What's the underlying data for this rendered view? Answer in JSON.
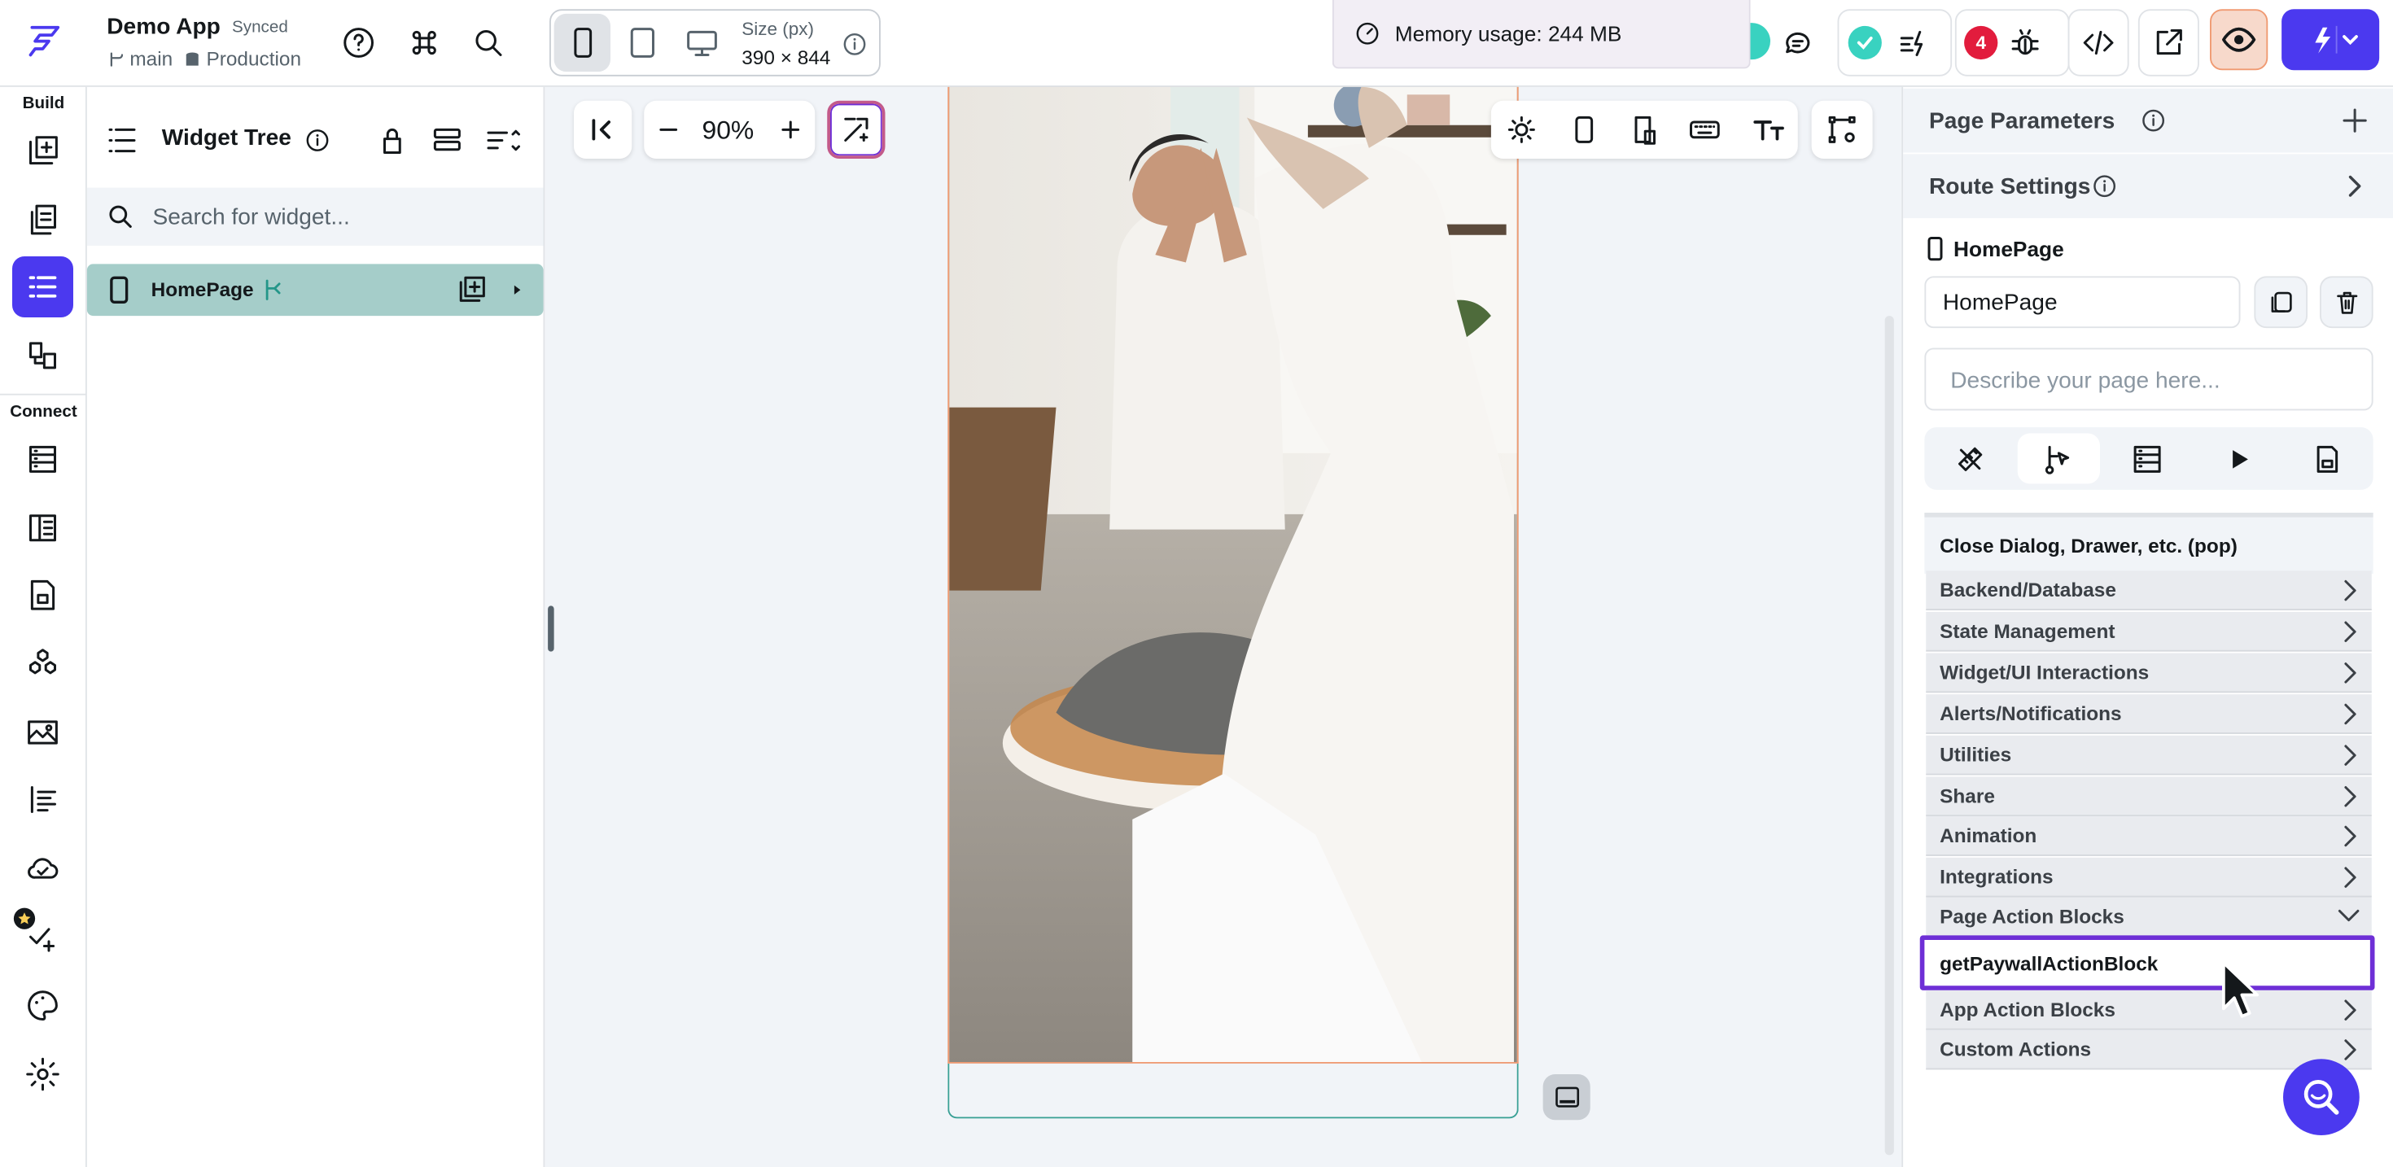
{
  "app": {
    "name": "Demo App",
    "sync_status": "Synced",
    "branch": "main",
    "environment": "Production"
  },
  "device": {
    "size_label": "Size (px)",
    "size_value": "390 × 844"
  },
  "memory": {
    "text": "Memory usage: 244 MB"
  },
  "top_right": {
    "error_count": "4"
  },
  "rail": {
    "build_label": "Build",
    "connect_label": "Connect"
  },
  "widget_tree": {
    "title": "Widget Tree",
    "search_placeholder": "Search for widget...",
    "items": [
      {
        "label": "HomePage"
      }
    ]
  },
  "canvas": {
    "zoom": "90%"
  },
  "props": {
    "page_parameters": "Page Parameters",
    "route_settings": "Route Settings",
    "page_label": "HomePage",
    "page_name_value": "HomePage",
    "description_placeholder": "Describe your page here...",
    "actions": {
      "top_item": "Close Dialog, Drawer, etc. (pop)",
      "categories": [
        "Backend/Database",
        "State Management",
        "Widget/UI Interactions",
        "Alerts/Notifications",
        "Utilities",
        "Share",
        "Animation",
        "Integrations",
        "Page Action Blocks"
      ],
      "highlighted": "getPaywallActionBlock",
      "bottom_categories": [
        "App Action Blocks",
        "Custom Actions"
      ]
    }
  },
  "colors": {
    "primary": "#4b39ef",
    "teal": "#39d2c0",
    "accent_border": "#6e2fd6",
    "error": "#e21c3d",
    "preview_bg": "#f7d9cb"
  }
}
